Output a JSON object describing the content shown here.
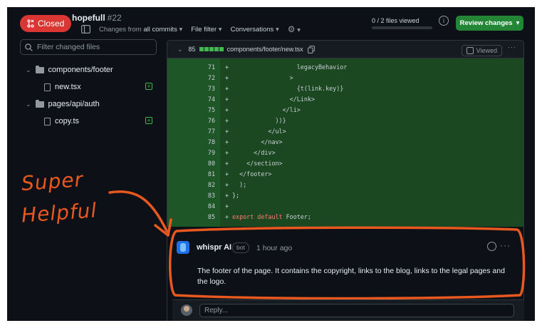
{
  "header": {
    "status_badge": "Closed",
    "repo_name": "hopefull",
    "pr_number": "#22",
    "changes_prefix": "Changes from",
    "changes_value": "all commits",
    "file_filter_label": "File filter",
    "conversations_label": "Conversations",
    "files_viewed": "0 / 2 files viewed",
    "review_button": "Review changes"
  },
  "sidebar": {
    "filter_placeholder": "Filter changed files",
    "tree": [
      {
        "type": "folder",
        "label": "components/footer"
      },
      {
        "type": "file",
        "label": "new.tsx",
        "status": "added"
      },
      {
        "type": "folder",
        "label": "pages/api/auth"
      },
      {
        "type": "file",
        "label": "copy.ts",
        "status": "added"
      }
    ]
  },
  "file": {
    "additions": "85",
    "path": "components/footer/new.tsx",
    "viewed_label": "Viewed"
  },
  "diff_lines": [
    {
      "n": "71",
      "code": "                  legacyBehavior"
    },
    {
      "n": "72",
      "code": "                >"
    },
    {
      "n": "73",
      "code": "                  {t(link.key)}"
    },
    {
      "n": "74",
      "code": "                </Link>"
    },
    {
      "n": "75",
      "code": "              </li>"
    },
    {
      "n": "76",
      "code": "            ))}"
    },
    {
      "n": "77",
      "code": "          </ul>"
    },
    {
      "n": "78",
      "code": "        </nav>"
    },
    {
      "n": "79",
      "code": "      </div>"
    },
    {
      "n": "80",
      "code": "    </section>"
    },
    {
      "n": "81",
      "code": "  </footer>"
    },
    {
      "n": "82",
      "code": "  );"
    },
    {
      "n": "83",
      "code": "};"
    },
    {
      "n": "84",
      "code": ""
    },
    {
      "n": "85",
      "code": "export default Footer;"
    }
  ],
  "comment": {
    "author": "whispr AI",
    "badge": "bot",
    "time": "1 hour ago",
    "body": "The footer of the page. It contains the copyright, links to the blog, links to the legal pages and the logo."
  },
  "reply": {
    "placeholder": "Reply..."
  },
  "annotation": {
    "line1": "Super",
    "line2": "Helpful"
  },
  "colors": {
    "closed": "#da3633",
    "review_button": "#238636",
    "diff_added_bg": "#1b4721",
    "annotation": "#e8581f"
  }
}
